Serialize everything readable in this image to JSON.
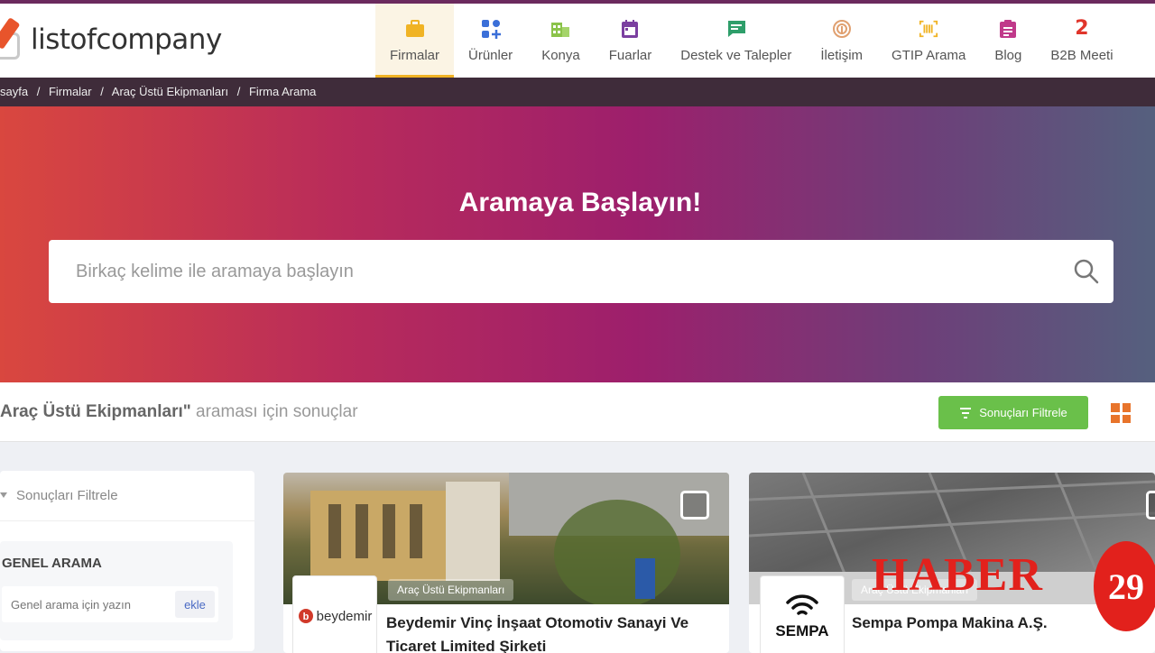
{
  "brand": {
    "name": "listofcompany"
  },
  "nav": [
    {
      "label": "Firmalar",
      "icon": "briefcase-icon",
      "color": "#f0b324",
      "active": true
    },
    {
      "label": "Ürünler",
      "icon": "grid-plus-icon",
      "color": "#3b6fd8"
    },
    {
      "label": "Konya",
      "icon": "building-icon",
      "color": "#8bc34a"
    },
    {
      "label": "Fuarlar",
      "icon": "calendar-icon",
      "color": "#7b3fa0"
    },
    {
      "label": "Destek ve Talepler",
      "icon": "chat-icon",
      "color": "#2e9e6a"
    },
    {
      "label": "İletişim",
      "icon": "fingerprint-icon",
      "color": "#e0a070"
    },
    {
      "label": "GTIP Arama",
      "icon": "barcode-icon",
      "color": "#f0b324"
    },
    {
      "label": "Blog",
      "icon": "clipboard-icon",
      "color": "#c0398a"
    },
    {
      "label": "B2B Meeti",
      "icon": "b2b-icon",
      "color": "#e0352b"
    }
  ],
  "breadcrumb": [
    "sayfa",
    "/",
    "Firmalar",
    "/",
    "Araç Üstü Ekipmanları",
    "/",
    "Firma Arama"
  ],
  "hero": {
    "title": "Aramaya Başlayın!",
    "search_placeholder": "Birkaç kelime ile aramaya başlayın"
  },
  "results": {
    "query": "Araç Üstü Ekipmanları\"",
    "suffix": " araması için sonuçlar",
    "filter_button": "Sonuçları Filtrele"
  },
  "sidebar": {
    "header": "Sonuçları Filtrele",
    "section_title": "GENEL ARAMA",
    "input_placeholder": "Genel arama için yazın",
    "add_button": "ekle"
  },
  "cards": [
    {
      "tag": "Araç Üstü Ekipmanları",
      "logo_text": "beydemir",
      "title": "Beydemir Vinç İnşaat Otomotiv Sanayi Ve Ticaret Limited Şirketi"
    },
    {
      "tag": "Araç Üstü Ekipmanları",
      "logo_text": "SEMPA",
      "title": "Sempa Pompa Makina A.Ş."
    }
  ],
  "watermark": {
    "text": "HABER",
    "number": "29"
  }
}
